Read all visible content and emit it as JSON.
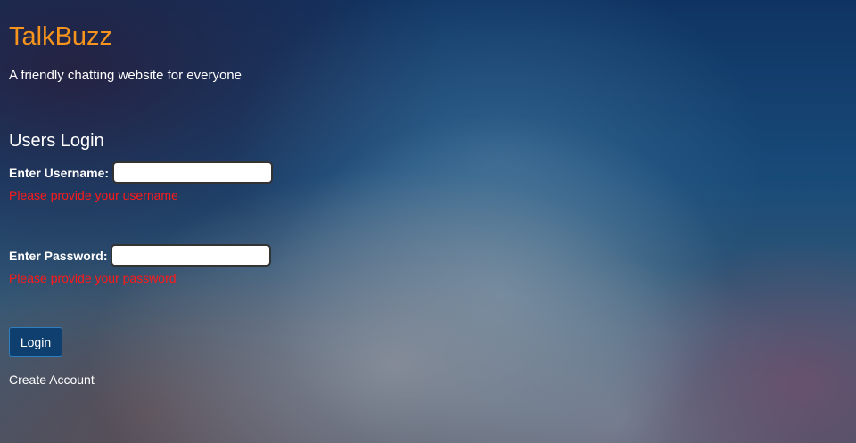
{
  "header": {
    "brand": "TalkBuzz",
    "tagline": "A friendly chatting website for everyone"
  },
  "login": {
    "title": "Users Login",
    "username": {
      "label": "Enter Username:",
      "value": "",
      "error": "Please provide your username"
    },
    "password": {
      "label": "Enter Password:",
      "value": "",
      "error": "Please provide your password"
    },
    "submit_label": "Login",
    "create_account_label": "Create Account"
  },
  "colors": {
    "brand": "#f7941d",
    "error": "#ff1a1a",
    "button_bg": "#0f3f6e"
  }
}
